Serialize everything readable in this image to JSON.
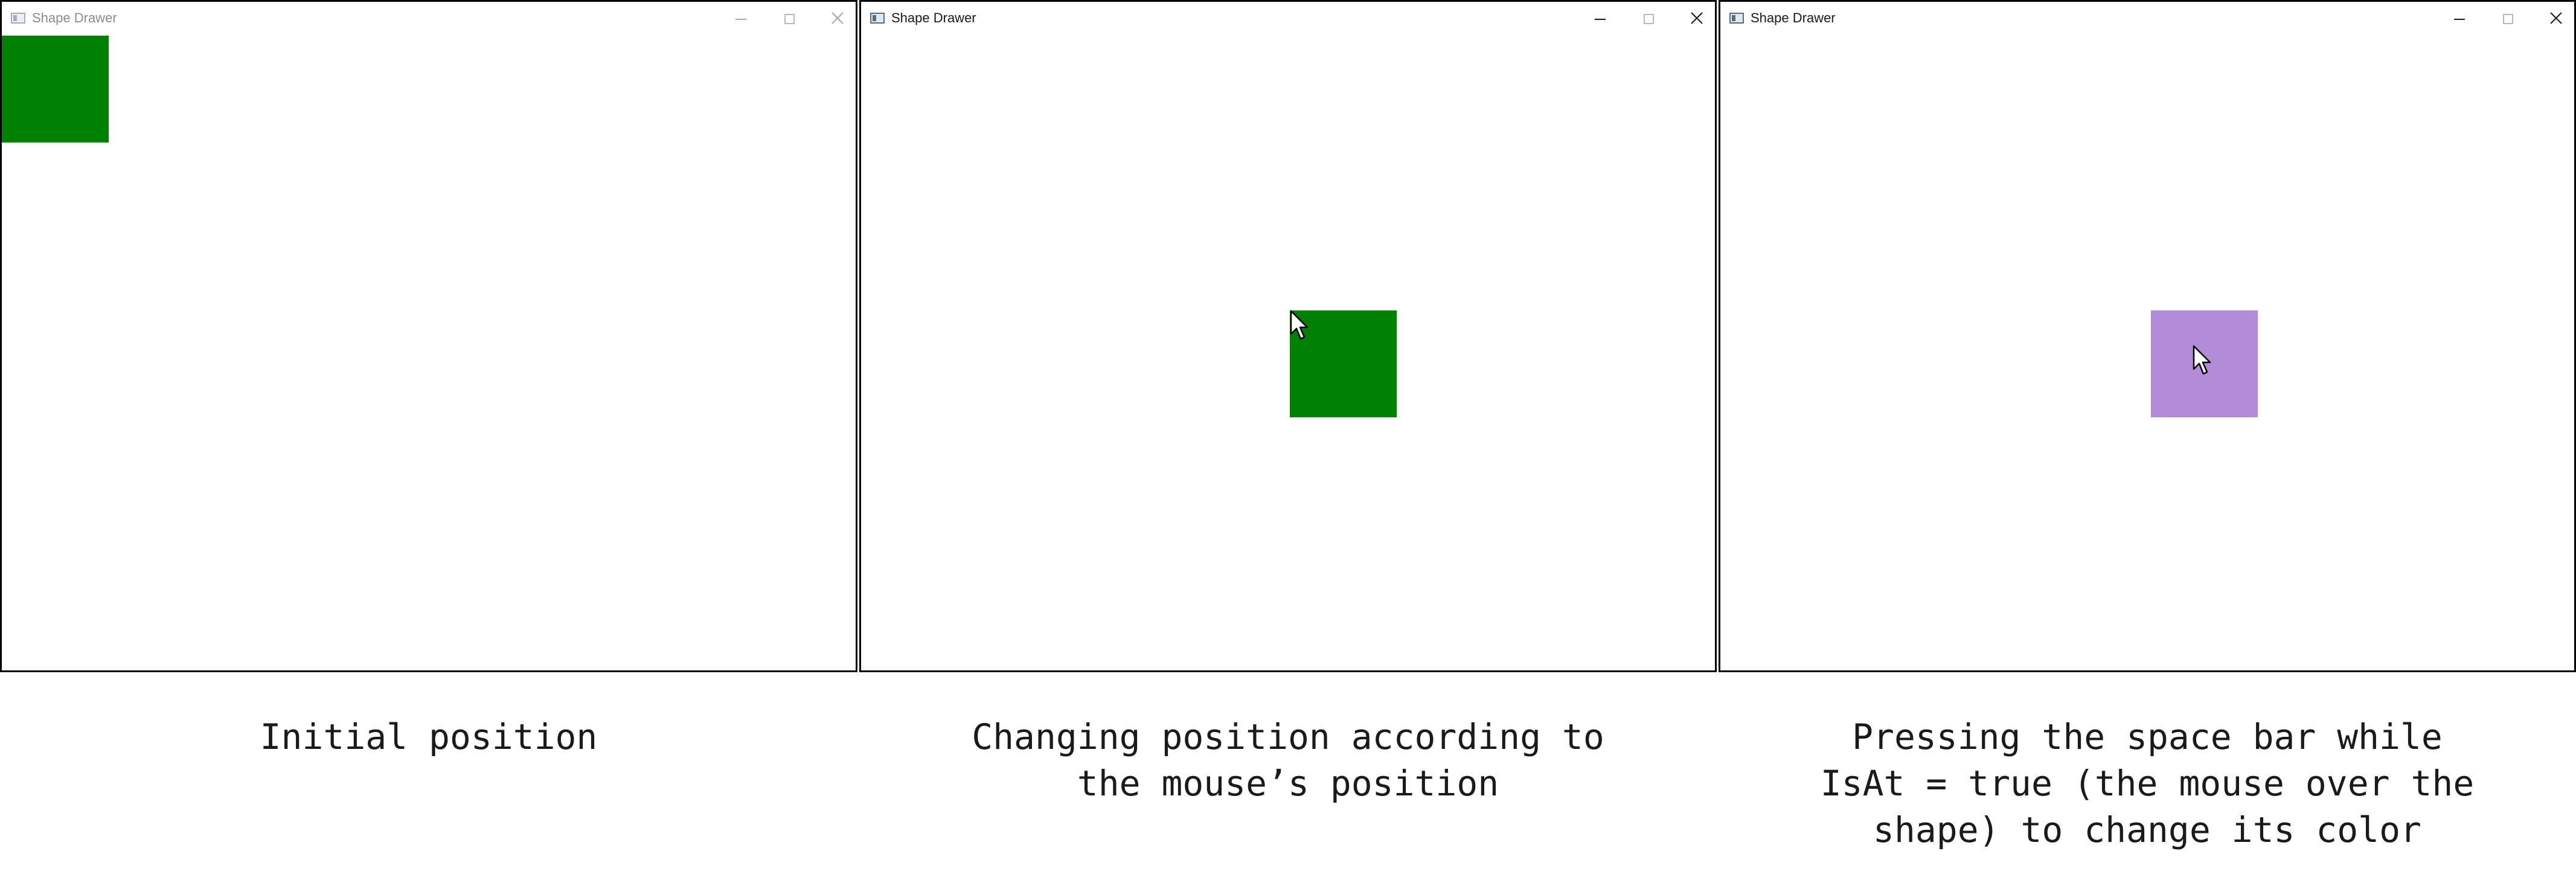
{
  "panels": [
    {
      "window": {
        "title": "Shape Drawer",
        "state": "inactive",
        "controls": [
          "minimize",
          "maximize",
          "close"
        ]
      },
      "shape": {
        "type": "rectangle",
        "color": "#008000"
      },
      "cursor_visible": false,
      "caption": "Initial position"
    },
    {
      "window": {
        "title": "Shape Drawer",
        "state": "active",
        "controls": [
          "minimize",
          "maximize",
          "close"
        ]
      },
      "shape": {
        "type": "rectangle",
        "color": "#008000"
      },
      "cursor_visible": true,
      "caption": "Changing position according to\nthe mouse’s position"
    },
    {
      "window": {
        "title": "Shape Drawer",
        "state": "active",
        "controls": [
          "minimize",
          "maximize",
          "close"
        ]
      },
      "shape": {
        "type": "rectangle",
        "color": "#b38cd9"
      },
      "cursor_visible": true,
      "caption": "Pressing the space bar while\nIsAt = true (the mouse over the\nshape) to change its color"
    }
  ],
  "icons": {
    "app": "app-window-icon",
    "minimize": "minimize-icon",
    "maximize": "maximize-icon",
    "close": "close-icon",
    "cursor": "mouse-pointer-icon"
  }
}
